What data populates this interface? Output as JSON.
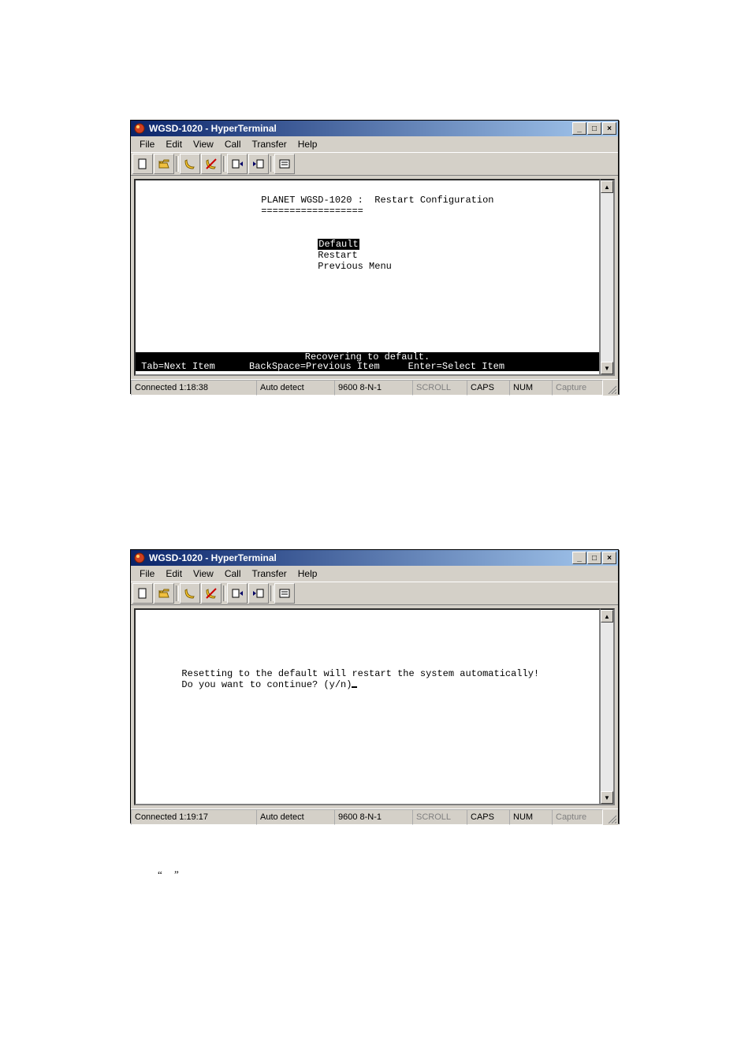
{
  "windows": [
    {
      "title": "WGSD-1020 - HyperTerminal",
      "menu": [
        "File",
        "Edit",
        "View",
        "Call",
        "Transfer",
        "Help"
      ],
      "terminal": {
        "header_left": "PLANET WGSD-1020 :",
        "header_right": "  Restart Configuration",
        "header_underline": "==================",
        "menu_items": [
          "Default",
          "Restart",
          "Previous Menu"
        ],
        "selected_index": 0,
        "footer_recover": "Recovering to default.",
        "footer_nav": "Tab=Next Item      BackSpace=Previous Item     Enter=Select Item"
      },
      "status": {
        "connected": "Connected 1:18:38",
        "detect": "Auto detect",
        "settings": "9600 8-N-1",
        "scroll": "SCROLL",
        "caps": "CAPS",
        "num": "NUM",
        "capture": "Capture"
      }
    },
    {
      "title": "WGSD-1020 - HyperTerminal",
      "menu": [
        "File",
        "Edit",
        "View",
        "Call",
        "Transfer",
        "Help"
      ],
      "terminal": {
        "body_line1": "Resetting to the default will restart the system automatically!",
        "body_line2": "Do you want to continue? (y/n)"
      },
      "status": {
        "connected": "Connected 1:19:17",
        "detect": "Auto detect",
        "settings": "9600 8-N-1",
        "scroll": "SCROLL",
        "caps": "CAPS",
        "num": "NUM",
        "capture": "Capture"
      }
    }
  ],
  "win_buttons": {
    "min": "_",
    "max": "□",
    "close": "×"
  },
  "scroll": {
    "up": "▲",
    "down": "▼"
  },
  "quote": "“  ”"
}
